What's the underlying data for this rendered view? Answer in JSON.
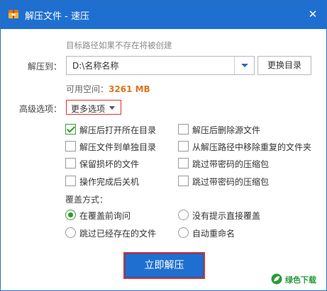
{
  "window": {
    "title": "解压文件 - 速压",
    "close_glyph": "✕",
    "app_icon": "archive-app-icon"
  },
  "hint": "目标路径如果不存在将被创建",
  "target": {
    "label": "解压到：",
    "path_value": "D:\\名称名称",
    "browse_label": "更换目录"
  },
  "space": {
    "label": "可用空间：",
    "value": "3261 MB"
  },
  "advanced": {
    "label": "高级选项：",
    "more_label": "更多选项"
  },
  "checkbox_options": [
    {
      "label": "解压后打开所在目录",
      "checked": true
    },
    {
      "label": "解压后删除源文件",
      "checked": false
    },
    {
      "label": "解压文件到单独目录",
      "checked": false
    },
    {
      "label": "从解压路径中移除重复的文件夹",
      "checked": false
    },
    {
      "label": "保留损坏的文件",
      "checked": false
    },
    {
      "label": "跳过带密码的压缩包",
      "checked": false
    },
    {
      "label": "操作完成后关机",
      "checked": false
    },
    {
      "label": "跳过带密码的压缩包",
      "checked": false
    }
  ],
  "overwrite": {
    "label": "覆盖方式：",
    "options": [
      {
        "label": "在覆盖前询问",
        "selected": true
      },
      {
        "label": "没有提示直接覆盖",
        "selected": false
      },
      {
        "label": "跳过已经存在的文件",
        "selected": false
      },
      {
        "label": "自动重命名",
        "selected": false
      }
    ]
  },
  "action": {
    "extract_label": "立即解压"
  },
  "watermark": {
    "text": "绿色下载"
  },
  "colors": {
    "titlebar": "#1f6fd0",
    "accent_orange": "#e0731a",
    "highlight_red": "#d9362f",
    "check_green": "#2d9a2d"
  }
}
